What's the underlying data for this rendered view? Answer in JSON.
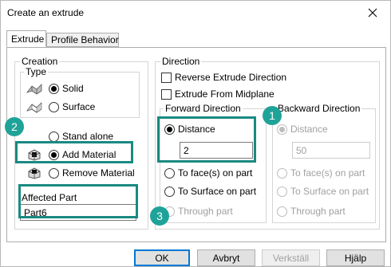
{
  "window": {
    "title": "Create an extrude",
    "close_icon": "close-icon"
  },
  "tabs": [
    {
      "label": "Extrude",
      "active": true
    },
    {
      "label": "Profile Behavior",
      "active": false
    }
  ],
  "creation": {
    "label": "Creation",
    "type": {
      "label": "Type",
      "options": [
        {
          "label": "Solid",
          "checked": true,
          "icon": "solid-extrude-icon"
        },
        {
          "label": "Surface",
          "checked": false,
          "icon": "surface-extrude-icon"
        }
      ]
    },
    "mode_options": [
      {
        "label": "Stand alone",
        "checked": false,
        "icon": ""
      },
      {
        "label": "Add Material",
        "checked": true,
        "icon": "add-material-icon"
      },
      {
        "label": "Remove Material",
        "checked": false,
        "icon": "remove-material-icon"
      }
    ],
    "affected_part": {
      "label": "Affected Part",
      "value": "Part6"
    }
  },
  "direction": {
    "label": "Direction",
    "reverse_label": "Reverse Extrude Direction",
    "midplane_label": "Extrude From Midplane",
    "forward": {
      "label": "Forward Direction",
      "distance_label": "Distance",
      "distance_value": "2",
      "options": [
        "To face(s) on part",
        "To Surface on part",
        "Through part"
      ]
    },
    "backward": {
      "label": "Backward Direction",
      "distance_label": "Distance",
      "distance_value": "50",
      "options": [
        "To face(s) on part",
        "To Surface on part",
        "Through part"
      ]
    }
  },
  "badges": [
    "1",
    "2",
    "3"
  ],
  "footer": {
    "ok": "OK",
    "cancel": "Avbryt",
    "apply": "Verkställ",
    "help": "Hjälp"
  },
  "colors": {
    "highlight": "#1a8a82",
    "badge": "#1fa398",
    "primary_border": "#0078d7"
  }
}
